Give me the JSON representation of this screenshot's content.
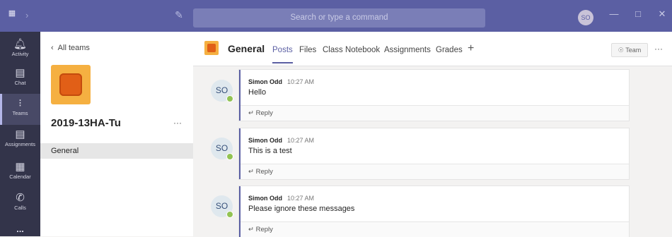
{
  "titlebar": {
    "search_placeholder": "Search or type a command",
    "user_initials": "SO",
    "icons": [
      "teams-app-icon",
      "back-arrow-icon",
      "compose-icon",
      "minimize-icon",
      "maximize-icon",
      "close-icon"
    ]
  },
  "rail": {
    "items": [
      {
        "label": "Activity",
        "icon": "bell-icon"
      },
      {
        "label": "Chat",
        "icon": "chat-icon"
      },
      {
        "label": "Teams",
        "icon": "teams-icon"
      },
      {
        "label": "Assignments",
        "icon": "assignments-icon"
      },
      {
        "label": "Calendar",
        "icon": "calendar-icon"
      },
      {
        "label": "Calls",
        "icon": "phone-icon"
      }
    ],
    "more_label": "..."
  },
  "teampane": {
    "all_teams_label": "All teams",
    "team_name": "2019-13HA-Tu",
    "more": "···",
    "channels": [
      "General"
    ]
  },
  "header": {
    "channel_title": "General",
    "tabs": [
      "Posts",
      "Files",
      "Class Notebook",
      "Assignments",
      "Grades"
    ],
    "add_tab": "+",
    "team_button": "Team",
    "more": "···"
  },
  "posts": [
    {
      "initials": "SO",
      "author": "Simon Odd",
      "time": "10:27 AM",
      "message": "Hello",
      "reply": "Reply"
    },
    {
      "initials": "SO",
      "author": "Simon Odd",
      "time": "10:27 AM",
      "message": "This is a test",
      "reply": "Reply"
    },
    {
      "initials": "SO",
      "author": "Simon Odd",
      "time": "10:27 AM",
      "message": "Please ignore these messages",
      "reply": "Reply"
    }
  ],
  "colors": {
    "brand": "#5b5fa3",
    "rail": "#33344a",
    "presence": "#92c353"
  }
}
